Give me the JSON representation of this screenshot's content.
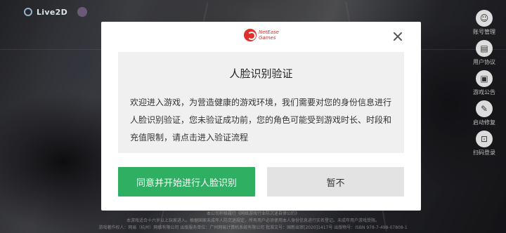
{
  "top_left": {
    "logo_text": "Live2D"
  },
  "side_menu": {
    "items": [
      {
        "icon": "user-center-icon",
        "label": "账号管理"
      },
      {
        "icon": "agreement-icon",
        "label": "用户协议"
      },
      {
        "icon": "notice-icon",
        "label": "游戏公告"
      },
      {
        "icon": "repair-icon",
        "label": "启动修复"
      },
      {
        "icon": "scan-icon",
        "label": "扫码登录"
      }
    ]
  },
  "legal": {
    "line1": "本公司积极履行《网络游戏行业防沉迷自律公约》",
    "line2": "本游戏适合十六岁以上玩家进入。根据国家未成年人防沉迷规定，所有用户必须使用本人身份信息进行实名登记。未成年用户游戏受限。",
    "line3": "游戏著作权人：网易（杭州）网络有限公司    出版服务单位：广州网易计算机系统有限公司    批准文号：国新出审[2020]1417号    出版物号：ISBN 978-7-498-07808-1"
  },
  "modal": {
    "brand_line1": "NetEase",
    "brand_line2": "Games",
    "title": "人脸识别验证",
    "body": "欢迎进入游戏，为营造健康的游戏环境，我们需要对您的身份信息进行人脸识别验证，您未验证成功前，您的角色可能受到游戏时长、时段和充值限制，请点击进入验证流程",
    "agree_label": "同意并开始进行人脸识别",
    "later_label": "暂不"
  },
  "colors": {
    "accent_green": "#2eaf62",
    "brand_red": "#e0302b",
    "secondary_button": "#e3e3e3"
  }
}
